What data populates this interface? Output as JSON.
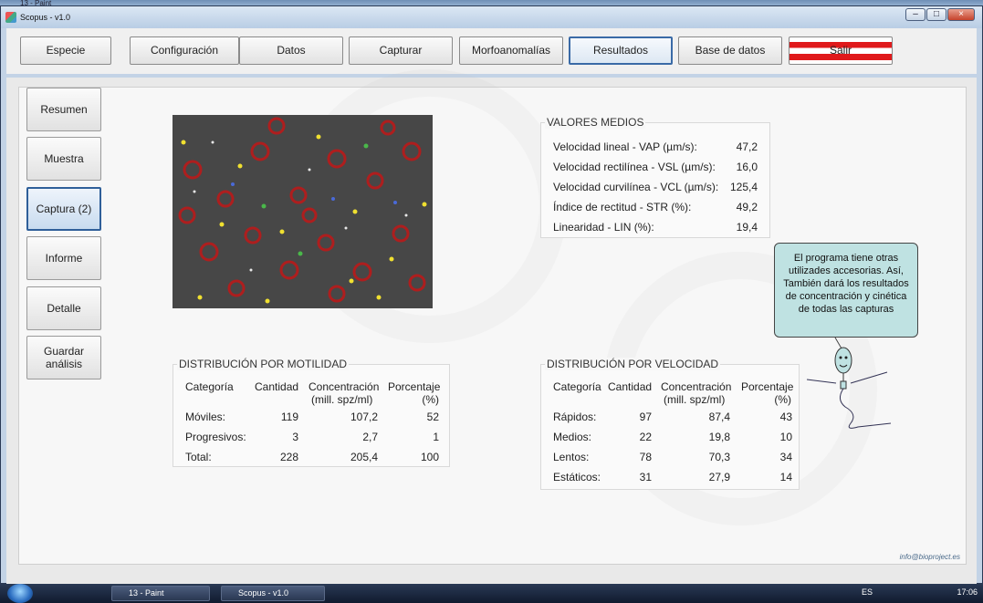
{
  "outer_title": "13 - Paint",
  "window": {
    "title": "Scopus - v1.0"
  },
  "nav": {
    "items": [
      "Especie",
      "Configuración",
      "Datos",
      "Capturar",
      "Morfoanomalías",
      "Resultados",
      "Base de datos",
      "Salir"
    ],
    "active": "Resultados"
  },
  "side": {
    "items": [
      "Resumen",
      "Muestra",
      "Captura (2)",
      "Informe",
      "Detalle",
      "Guardar análisis"
    ],
    "active": "Captura (2)"
  },
  "valores_medios": {
    "title": "VALORES MEDIOS",
    "rows": [
      {
        "label": "Velocidad lineal - VAP (µm/s):",
        "value": "47,2"
      },
      {
        "label": "Velocidad rectilínea - VSL (µm/s):",
        "value": "16,0"
      },
      {
        "label": "Velocidad curvilínea - VCL (µm/s):",
        "value": "125,4"
      },
      {
        "label": "Índice de rectitud - STR (%):",
        "value": "49,2"
      },
      {
        "label": "Linearidad - LIN (%):",
        "value": "19,4"
      }
    ]
  },
  "motilidad": {
    "title": "DISTRIBUCIÓN POR MOTILIDAD",
    "headers": {
      "cat": "Categoría",
      "cant": "Cantidad",
      "conc1": "Concentración",
      "conc2": "(mill. spz/ml)",
      "porc1": "Porcentaje",
      "porc2": "(%)"
    },
    "rows": [
      {
        "cat": "Móviles:",
        "cant": "119",
        "conc": "107,2",
        "porc": "52"
      },
      {
        "cat": "Progresivos:",
        "cant": "3",
        "conc": "2,7",
        "porc": "1"
      },
      {
        "cat": "Total:",
        "cant": "228",
        "conc": "205,4",
        "porc": "100"
      }
    ]
  },
  "velocidad": {
    "title": "DISTRIBUCIÓN POR VELOCIDAD",
    "headers": {
      "cat": "Categoría",
      "cant": "Cantidad",
      "conc1": "Concentración",
      "conc2": "(mill. spz/ml)",
      "porc1": "Porcentaje",
      "porc2": "(%)"
    },
    "rows": [
      {
        "cat": "Rápidos:",
        "cant": "97",
        "conc": "87,4",
        "porc": "43"
      },
      {
        "cat": "Medios:",
        "cant": "22",
        "conc": "19,8",
        "porc": "10"
      },
      {
        "cat": "Lentos:",
        "cant": "78",
        "conc": "70,3",
        "porc": "34"
      },
      {
        "cat": "Estáticos:",
        "cant": "31",
        "conc": "27,9",
        "porc": "14"
      }
    ]
  },
  "callout": "El programa tiene otras utilizades accesorias. Así,  También dará los resultados de concentración y cinética de todas las capturas",
  "credit": "info@bioproject.es",
  "taskbar": {
    "items": [
      "13 - Paint",
      "Scopus - v1.0"
    ],
    "tray_lang": "ES",
    "clock": "17:06"
  },
  "colors": {
    "accent": "#3a6aa6",
    "exit": "#e0191b",
    "callout_bg": "#bfe2e2"
  }
}
